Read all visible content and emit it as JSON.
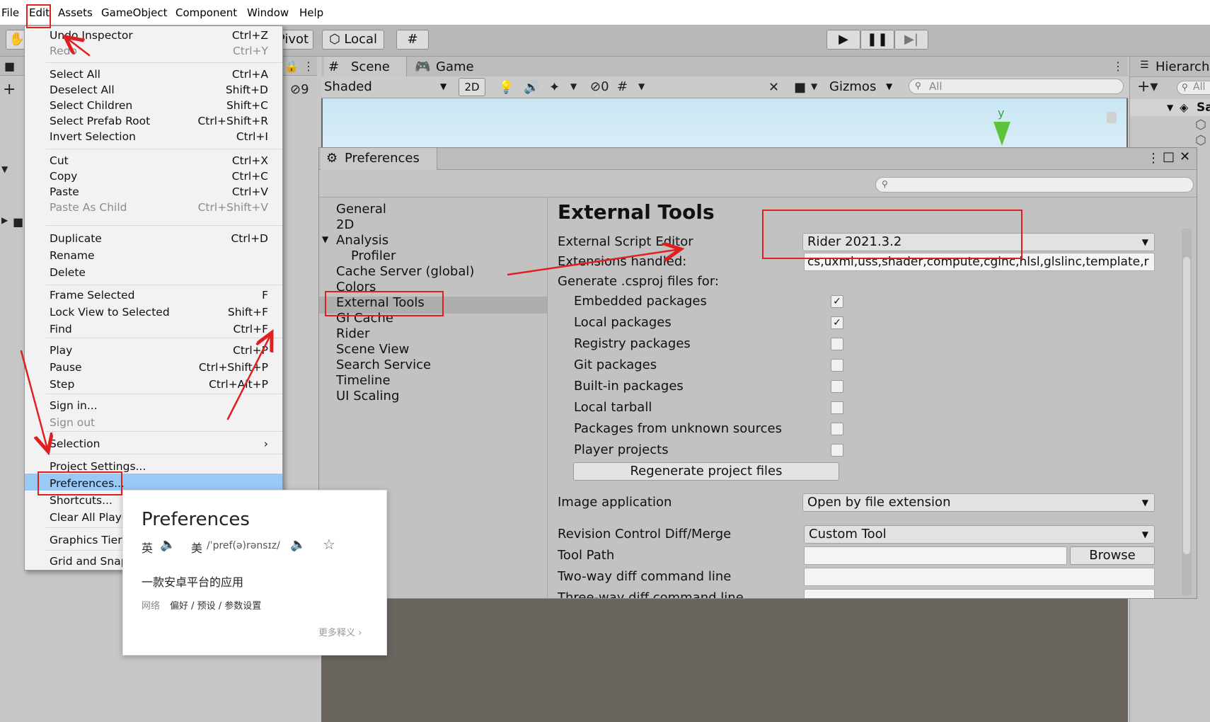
{
  "menubar": {
    "items": [
      "File",
      "Edit",
      "Assets",
      "GameObject",
      "Component",
      "Window",
      "Help"
    ]
  },
  "toolbar": {
    "pivot": "Pivot",
    "local": "Local"
  },
  "scene": {
    "tab_scene": "Scene",
    "tab_game": "Game",
    "shading": "Shaded",
    "mode2d": "2D",
    "hidden_count": "0",
    "gizmos": "Gizmos",
    "search_placeholder": "All",
    "axis_label": "y",
    "left_count": "9"
  },
  "hierarchy": {
    "title": "Hierarchy",
    "search_placeholder": "All",
    "scene_root": "Sa"
  },
  "edit_menu": {
    "items": [
      {
        "label": "Undo Inspector",
        "shortcut": "Ctrl+Z"
      },
      {
        "label": "Redo",
        "shortcut": "Ctrl+Y"
      },
      {
        "label": "Select All",
        "shortcut": "Ctrl+A"
      },
      {
        "label": "Deselect All",
        "shortcut": "Shift+D"
      },
      {
        "label": "Select Children",
        "shortcut": "Shift+C"
      },
      {
        "label": "Select Prefab Root",
        "shortcut": "Ctrl+Shift+R"
      },
      {
        "label": "Invert Selection",
        "shortcut": "Ctrl+I"
      },
      {
        "label": "Cut",
        "shortcut": "Ctrl+X"
      },
      {
        "label": "Copy",
        "shortcut": "Ctrl+C"
      },
      {
        "label": "Paste",
        "shortcut": "Ctrl+V"
      },
      {
        "label": "Paste As Child",
        "shortcut": "Ctrl+Shift+V"
      },
      {
        "label": "Duplicate",
        "shortcut": "Ctrl+D"
      },
      {
        "label": "Rename",
        "shortcut": ""
      },
      {
        "label": "Delete",
        "shortcut": ""
      },
      {
        "label": "Frame Selected",
        "shortcut": "F"
      },
      {
        "label": "Lock View to Selected",
        "shortcut": "Shift+F"
      },
      {
        "label": "Find",
        "shortcut": "Ctrl+F"
      },
      {
        "label": "Play",
        "shortcut": "Ctrl+P"
      },
      {
        "label": "Pause",
        "shortcut": "Ctrl+Shift+P"
      },
      {
        "label": "Step",
        "shortcut": "Ctrl+Alt+P"
      },
      {
        "label": "Sign in...",
        "shortcut": ""
      },
      {
        "label": "Sign out",
        "shortcut": ""
      },
      {
        "label": "Selection",
        "shortcut": "›"
      },
      {
        "label": "Project Settings...",
        "shortcut": ""
      },
      {
        "label": "Preferences...",
        "shortcut": ""
      },
      {
        "label": "Shortcuts...",
        "shortcut": ""
      },
      {
        "label": "Clear All Playe",
        "shortcut": ""
      },
      {
        "label": "Graphics Tier",
        "shortcut": ""
      },
      {
        "label": "Grid and Snap",
        "shortcut": ""
      }
    ]
  },
  "preferences": {
    "window_title": "Preferences",
    "nav": [
      "General",
      "2D",
      "Analysis",
      "Profiler",
      "Cache Server (global)",
      "Colors",
      "External Tools",
      "GI Cache",
      "Rider",
      "Scene View",
      "Search Service",
      "Timeline",
      "UI Scaling"
    ],
    "section_title": "External Tools",
    "external_script_editor_label": "External Script Editor",
    "external_script_editor_value": "Rider 2021.3.2",
    "extensions_label": "Extensions handled:",
    "extensions_value": "cs,uxml,uss,shader,compute,cginc,hlsl,glslinc,template,r",
    "generate_label": "Generate .csproj files for:",
    "packages": [
      {
        "label": "Embedded packages",
        "checked": "✓"
      },
      {
        "label": "Local packages",
        "checked": "✓"
      },
      {
        "label": "Registry packages",
        "checked": ""
      },
      {
        "label": "Git packages",
        "checked": ""
      },
      {
        "label": "Built-in packages",
        "checked": ""
      },
      {
        "label": "Local tarball",
        "checked": ""
      },
      {
        "label": "Packages from unknown sources",
        "checked": ""
      },
      {
        "label": "Player projects",
        "checked": ""
      }
    ],
    "regenerate_button": "Regenerate project files",
    "image_app_label": "Image application",
    "image_app_value": "Open by file extension",
    "revision_label": "Revision Control Diff/Merge",
    "revision_value": "Custom Tool",
    "tool_path_label": "Tool Path",
    "browse_button": "Browse",
    "two_way_label": "Two-way diff command line",
    "three_way_label": "Three-way diff command line"
  },
  "dictionary": {
    "word": "Preferences",
    "uk_label": "英",
    "us_label": "美",
    "phonetic": "ˈpref(ə)rənsɪz",
    "definition": "一款安卓平台的应用",
    "web_label": "网络",
    "web_meanings": "偏好 / 预设 / 参数设置",
    "more_link": "更多释义"
  },
  "colors": {
    "annotation_red": "#e02020",
    "menu_highlight": "#99c9f5",
    "selected_nav": "#aeaeae"
  }
}
